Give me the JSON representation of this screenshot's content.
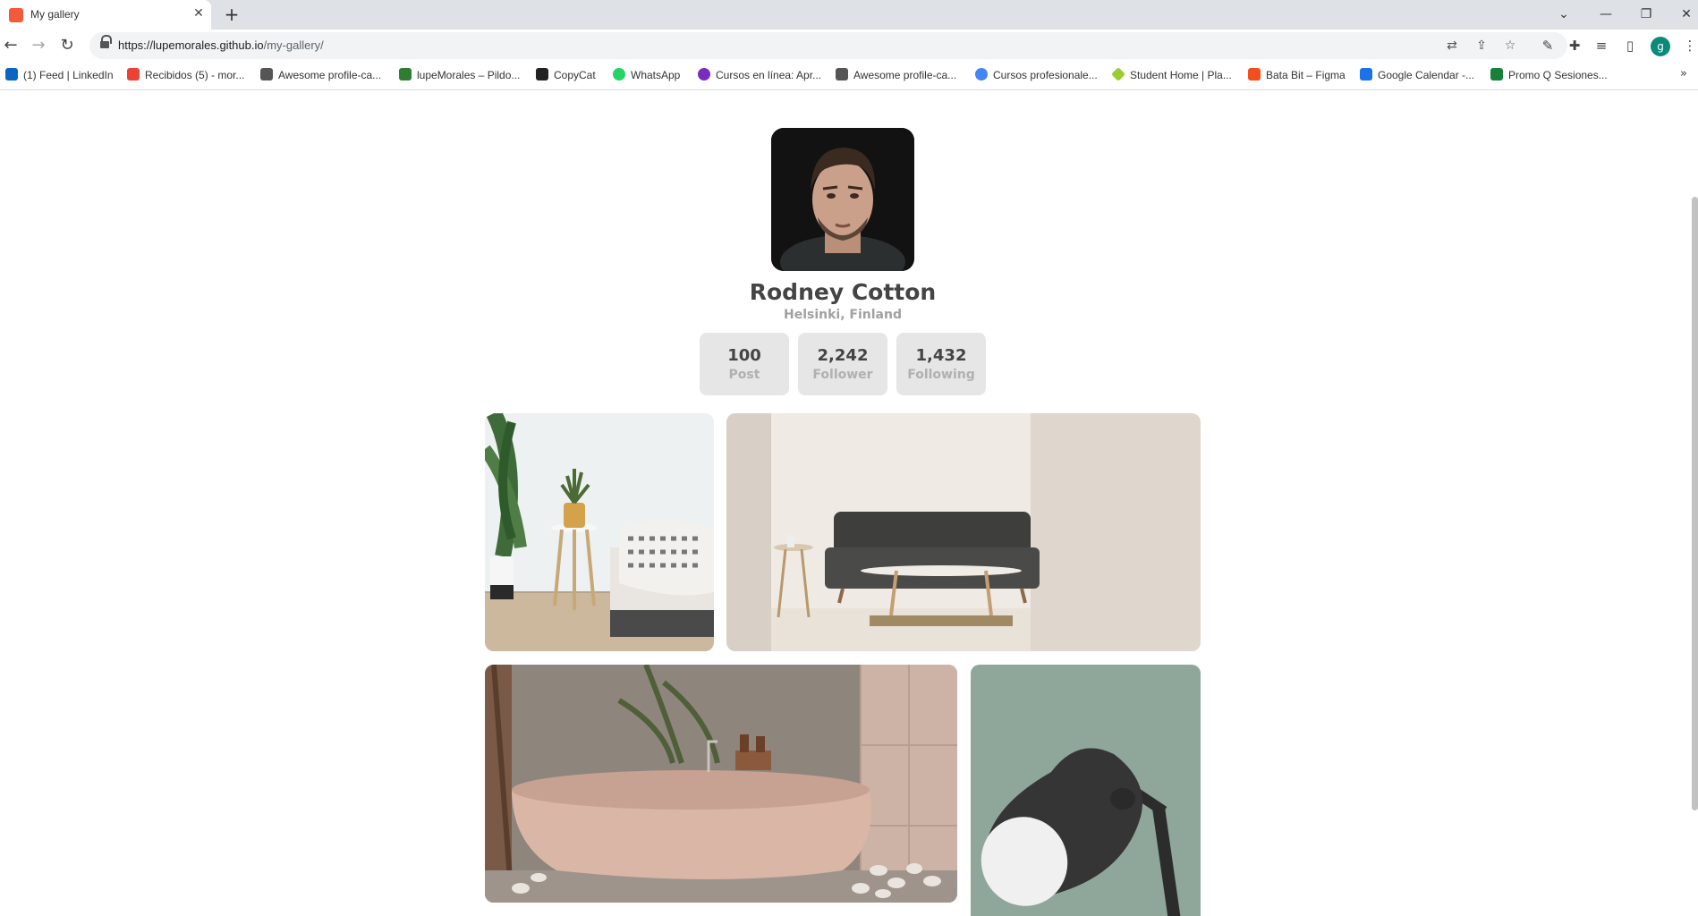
{
  "browser": {
    "tab_title": "My gallery",
    "url_host": "https://lupemorales.github.io",
    "url_path": "/my-gallery/",
    "profile_initial": "g",
    "bookmarks": [
      "(1) Feed | LinkedIn",
      "Recibidos (5) - mor...",
      "Awesome profile-ca...",
      "lupeMorales – Pildo...",
      "CopyCat",
      "WhatsApp",
      "Cursos en línea: Apr...",
      "Awesome profile-ca...",
      "Cursos profesionale...",
      "Student Home | Pla...",
      "Bata Bit – Figma",
      "Google Calendar -...",
      "Promo Q Sesiones..."
    ],
    "bookmark_more": "»"
  },
  "profile": {
    "name": "Rodney Cotton",
    "location": "Helsinki, Finland",
    "stats": [
      {
        "value": "100",
        "label": "Post"
      },
      {
        "value": "2,242",
        "label": "Follower"
      },
      {
        "value": "1,432",
        "label": "Following"
      }
    ]
  },
  "gallery": {
    "photos": [
      {
        "subject": "bedroom with plant and side table"
      },
      {
        "subject": "dark sofa living room"
      },
      {
        "subject": "pink stone bathtub"
      },
      {
        "subject": "black desk lamp on green wall"
      }
    ]
  },
  "icons": {
    "back": "back-arrow-icon",
    "forward": "forward-arrow-icon",
    "reload": "reload-icon",
    "lock": "lock-icon",
    "translate": "translate-icon",
    "share": "share-icon",
    "star": "star-icon",
    "extensions": "puzzle-icon"
  }
}
